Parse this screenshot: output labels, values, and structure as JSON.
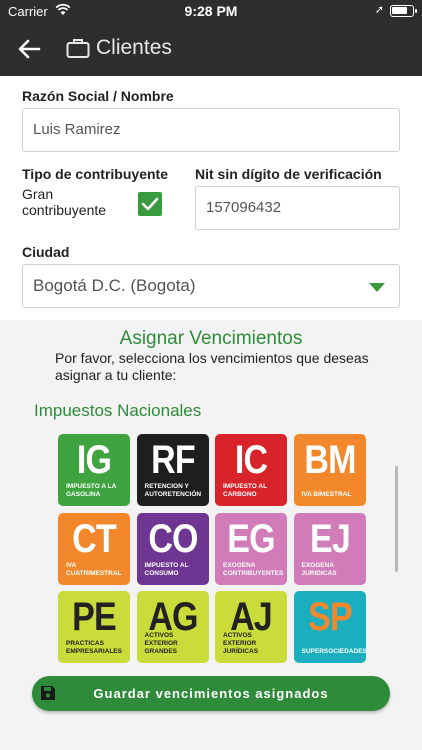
{
  "status_bar": {
    "carrier": "Carrier",
    "time": "9:28 PM"
  },
  "nav": {
    "title": "Clientes"
  },
  "form": {
    "razon_label": "Razón Social / Nombre",
    "razon_value": "Luis Ramirez",
    "tipo_label": "Tipo de contribuyente",
    "gran_label": "Gran contribuyente",
    "gran_checked": true,
    "nit_label": "Nit sin dígito de verificación",
    "nit_value": "157096432",
    "ciudad_label": "Ciudad",
    "ciudad_value": "Bogotá D.C. (Bogota)"
  },
  "assign": {
    "title": "Asignar Vencimientos",
    "description": "Por favor, selecciona los vencimientos que deseas asignar a tu cliente:",
    "section_title": "Impuestos Nacionales"
  },
  "tiles": [
    {
      "code": "IG",
      "desc": "Impuesto a la gasolina",
      "color": "#3fa33f"
    },
    {
      "code": "RF",
      "desc": "Retencion y autoretención",
      "color": "#1e1e1e"
    },
    {
      "code": "IC",
      "desc": "Impuesto al carbono",
      "color": "#d8232a"
    },
    {
      "code": "BM",
      "desc": "IVA Bimestral",
      "color": "#f2882b"
    },
    {
      "code": "CT",
      "desc": "IVA Cuatrimestral",
      "color": "#f2882b"
    },
    {
      "code": "CO",
      "desc": "Impuesto al consumo",
      "color": "#6f3592"
    },
    {
      "code": "EG",
      "desc": "Exogena contribuyentes",
      "color": "#d17bb8"
    },
    {
      "code": "EJ",
      "desc": "Exogena juridicas",
      "color": "#d17bb8"
    },
    {
      "code": "PE",
      "desc": "Practicas empresariales",
      "color": "#c9dc3a"
    },
    {
      "code": "AG",
      "desc": "Activos exterior grandes",
      "color": "#c9dc3a"
    },
    {
      "code": "AJ",
      "desc": "Activos exterior jurídicas",
      "color": "#c9dc3a"
    },
    {
      "code": "SP",
      "desc": "Supersociedades",
      "color": "#1aaebf",
      "code_color": "#f2882b"
    }
  ],
  "save_button": {
    "label": "Guardar vencimientos asignados"
  }
}
